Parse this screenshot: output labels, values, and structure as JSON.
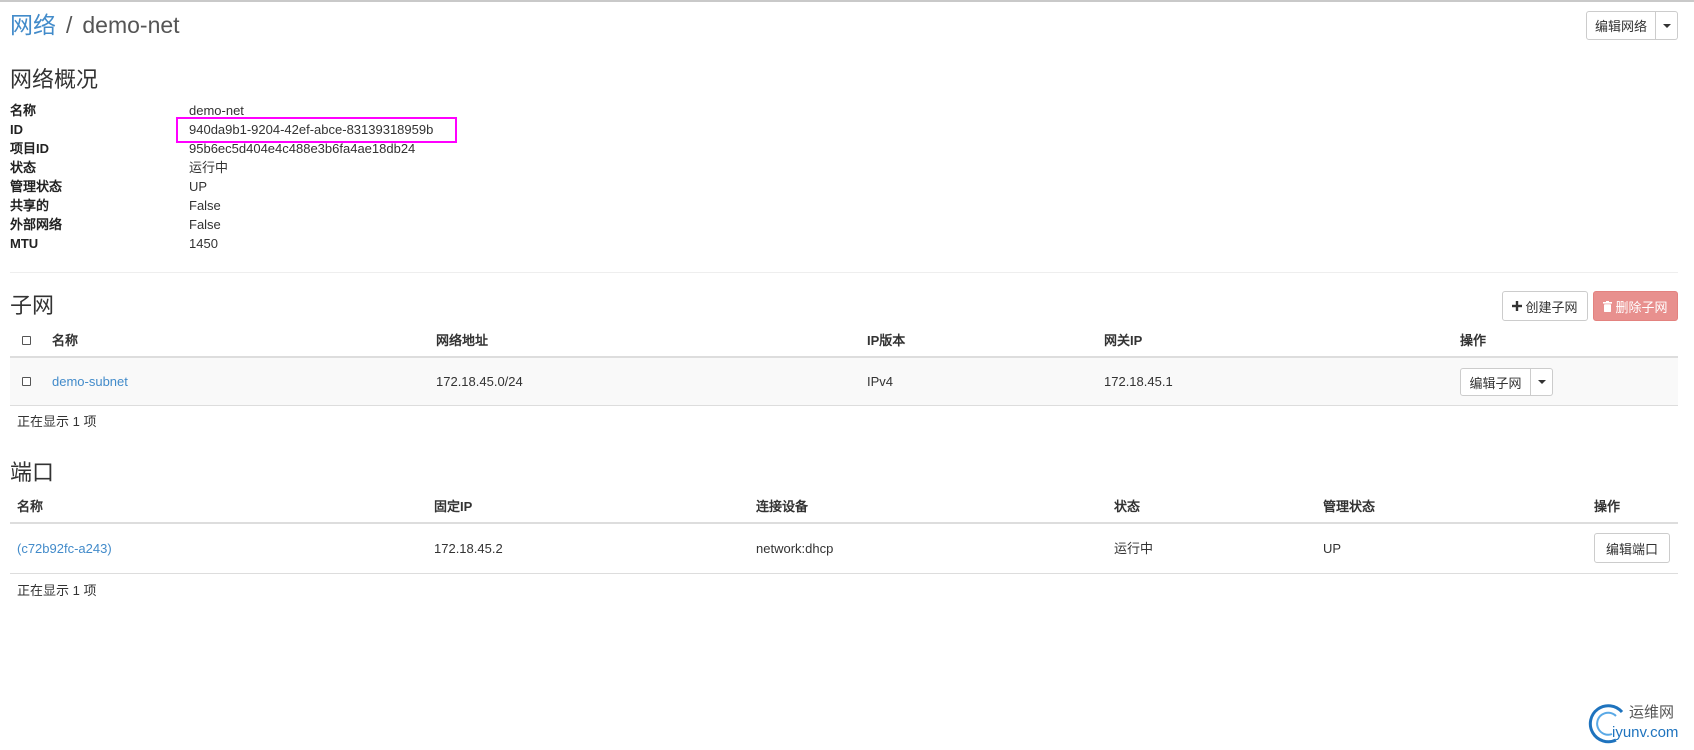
{
  "breadcrumb": {
    "parent": "网络",
    "separator": "/",
    "current": "demo-net"
  },
  "header_actions": {
    "edit_network": "编辑网络"
  },
  "overview": {
    "title": "网络概况",
    "fields": [
      {
        "label": "名称",
        "value": "demo-net"
      },
      {
        "label": "ID",
        "value": "940da9b1-9204-42ef-abce-83139318959b"
      },
      {
        "label": "项目ID",
        "value": "95b6ec5d404e4c488e3b6fa4ae18db24"
      },
      {
        "label": "状态",
        "value": "运行中"
      },
      {
        "label": "管理状态",
        "value": "UP"
      },
      {
        "label": "共享的",
        "value": "False"
      },
      {
        "label": "外部网络",
        "value": "False"
      },
      {
        "label": "MTU",
        "value": "1450"
      }
    ]
  },
  "subnets": {
    "title": "子网",
    "create_label": "创建子网",
    "delete_label": "删除子网",
    "delete_disabled": true,
    "columns": [
      "名称",
      "网络地址",
      "IP版本",
      "网关IP",
      "操作"
    ],
    "select_all_checked": false,
    "rows": [
      {
        "checked": false,
        "name": "demo-subnet",
        "cidr": "172.18.45.0/24",
        "ip_version": "IPv4",
        "gateway": "172.18.45.1",
        "action": "编辑子网"
      }
    ],
    "footer": "正在显示 1 项"
  },
  "ports": {
    "title": "端口",
    "columns": [
      "名称",
      "固定IP",
      "连接设备",
      "状态",
      "管理状态",
      "操作"
    ],
    "rows": [
      {
        "name": "(c72b92fc-a243)",
        "fixed_ip": "172.18.45.2",
        "device": "network:dhcp",
        "status": "运行中",
        "admin_state": "UP",
        "action": "编辑端口"
      }
    ],
    "footer": "正在显示 1 项"
  },
  "watermark": {
    "site_name": "运维网",
    "domain": "iyunv.com"
  },
  "icons": {
    "create": "plus-icon",
    "delete": "trash-icon",
    "dropdown": "caret-down-icon",
    "watermark": "iyunv-logo-icon"
  },
  "colors": {
    "link": "#428bca",
    "danger": "#e8908e",
    "highlight": "#ff00ff",
    "brand": "#1e73be"
  }
}
